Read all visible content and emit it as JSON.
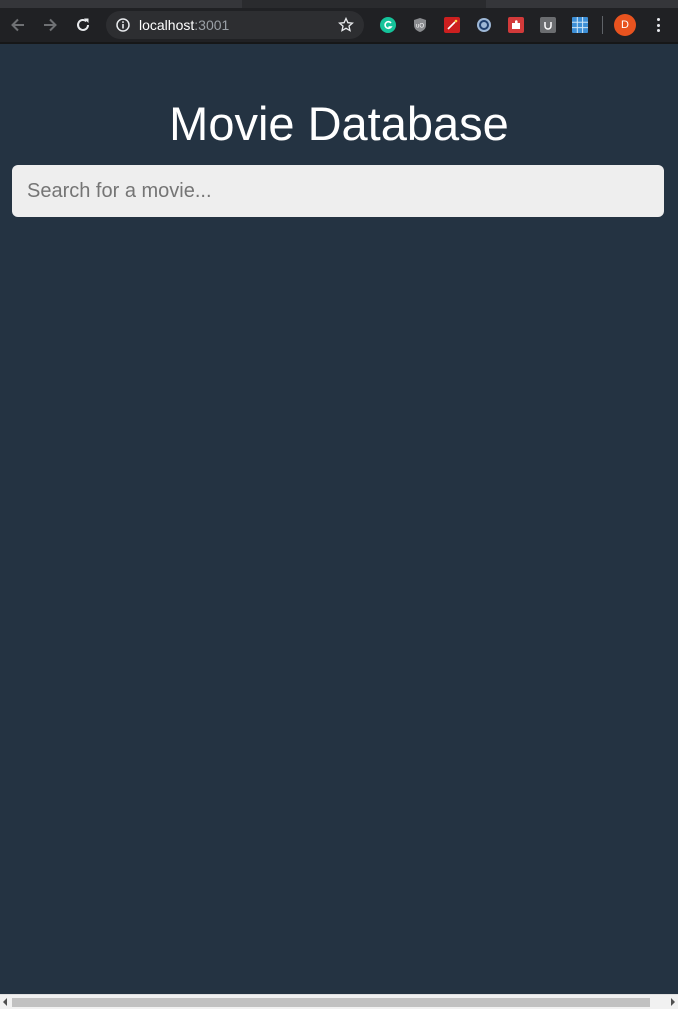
{
  "browser": {
    "url_host": "localhost",
    "url_port": ":3001",
    "profile_initial": "D",
    "extensions": [
      "grammarly-icon",
      "ublock-icon",
      "wand-icon",
      "circle-extension-icon",
      "puzzle-extension-icon",
      "cup-extension-icon",
      "grid-extension-icon"
    ]
  },
  "app": {
    "title": "Movie Database",
    "search": {
      "placeholder": "Search for a movie...",
      "value": ""
    }
  },
  "colors": {
    "background": "#243342",
    "search_bg": "#eeeeee",
    "avatar": "#e8531f"
  }
}
